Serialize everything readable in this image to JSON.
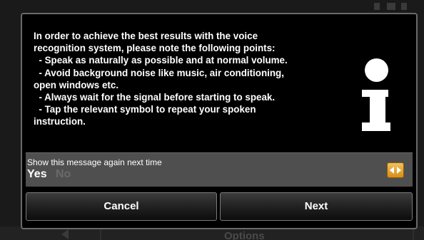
{
  "background": {
    "options_label": "Options"
  },
  "dialog": {
    "message_lines": [
      "In order to achieve the best results with the voice",
      "recognition system, please note the following points:",
      "  - Speak as naturally as possible and at normal volume.",
      "  - Avoid background noise like music, air conditioning,",
      "open windows etc.",
      "  - Always wait for the signal before starting to speak.",
      "  - Tap the relevant symbol to repeat your spoken",
      "instruction."
    ],
    "icon": "info-icon",
    "show_again": {
      "label": "Show this message again next time",
      "selected_option": "Yes",
      "unselected_option": "No"
    },
    "buttons": {
      "cancel_label": "Cancel",
      "next_label": "Next"
    }
  },
  "colors": {
    "dialog_bg": "#000000",
    "option_bar_bg": "#4f4f4f",
    "toggle_accent": "#e8a630",
    "unselected_text": "#6a6a6a"
  }
}
